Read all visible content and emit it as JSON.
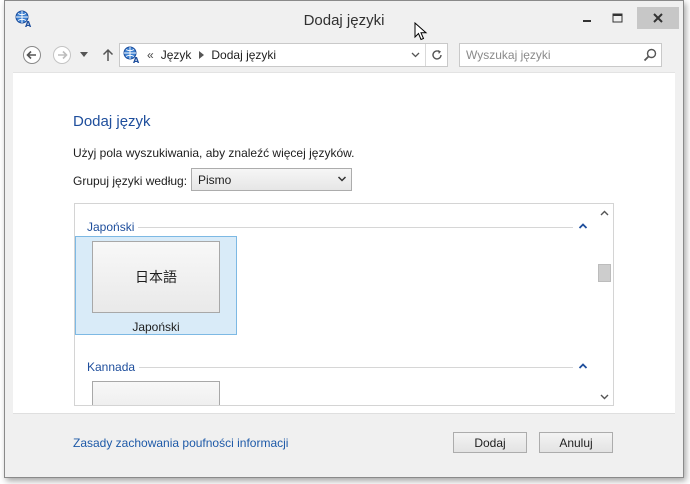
{
  "window": {
    "title": "Dodaj języki",
    "app_icon": "language-globe-icon"
  },
  "navigation": {
    "back_icon": "back-arrow-icon",
    "forward_icon": "forward-arrow-icon",
    "recent_icon": "chevron-down-icon",
    "up_icon": "up-arrow-icon",
    "address_separator": "«",
    "breadcrumbs": [
      "Język",
      "Dodaj języki"
    ],
    "refresh_icon": "refresh-icon"
  },
  "search": {
    "placeholder": "Wyszukaj języki",
    "value": "",
    "icon": "search-icon"
  },
  "main": {
    "heading": "Dodaj język",
    "instruction": "Użyj pola wyszukiwania, aby znaleźć więcej języków.",
    "group_by_label": "Grupuj języki według:",
    "group_by_value": "Pismo"
  },
  "language_groups": [
    {
      "name": "Japoński",
      "languages": [
        {
          "native": "日本語",
          "label": "Japoński",
          "selected": true
        }
      ]
    },
    {
      "name": "Kannada",
      "languages": [
        {
          "native": "",
          "label": "",
          "selected": false
        }
      ]
    }
  ],
  "footer": {
    "privacy_link": "Zasady zachowania poufności informacji",
    "add_button": "Dodaj",
    "cancel_button": "Anuluj"
  },
  "colors": {
    "heading": "#1e4e9c",
    "link": "#1e5aa8",
    "selected_tile": "#d9ebf8",
    "selected_border": "#7db9e4"
  }
}
